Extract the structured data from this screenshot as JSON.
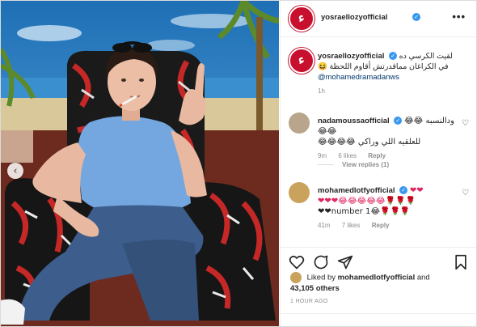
{
  "post": {
    "author": "yosraellozyofficial",
    "more_label": "•••",
    "caption_line1": "لقيت الكرسي ده",
    "caption_line2": "في الكراغان مماقدرتش أقاوم اللحظة 😆",
    "caption_mention": "@mohamedramadanws",
    "caption_time": "1h",
    "prev_label": "‹"
  },
  "comments": [
    {
      "user": "nadamoussaofficial",
      "text_line1": "ودالنسبه 😂😂😂😂",
      "text_line2": "للعلقيه اللي وراكي 😂😂😂😂",
      "time": "9m",
      "likes": "6 likes",
      "reply": "Reply",
      "view_replies": "View replies (1)"
    },
    {
      "user": "mohamedlotfyofficial",
      "text_line1": "❤❤",
      "text_line2": "❤❤❤😂😂😂😂😂🌹🌹🌹",
      "text_line3": "❤❤number 1😂🌹🌹🌹",
      "time": "41m",
      "likes": "7 likes",
      "reply": "Reply"
    }
  ],
  "liked_by": {
    "prefix": "Liked by",
    "user": "mohamedlotfyofficial",
    "and": "and",
    "count": "43,105 others"
  },
  "timestamp": "1 HOUR AGO",
  "icons": [
    "heart-icon",
    "comment-icon",
    "share-icon",
    "bookmark-icon",
    "verified-icon"
  ],
  "colors": {
    "brand": "#c8102e",
    "verified": "#3897f0",
    "mention": "#00376b"
  }
}
